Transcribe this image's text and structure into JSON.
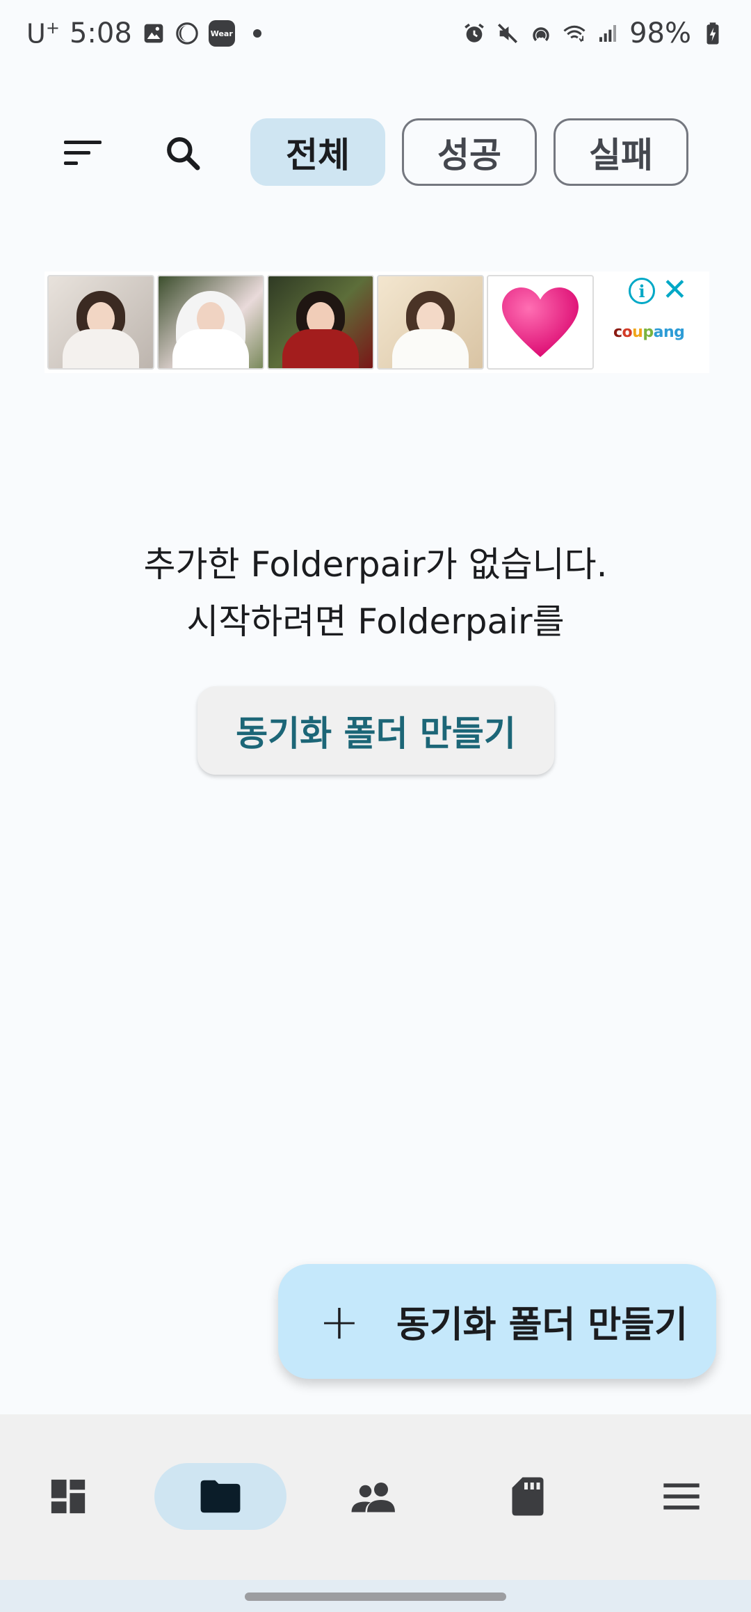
{
  "status_bar": {
    "carrier": "U",
    "carrier_sup": "+",
    "time": "5:08",
    "wear_label": "Wear",
    "battery": "98%",
    "icons": [
      "gallery-icon",
      "do-not-disturb-icon",
      "wear-icon",
      "alarm-icon",
      "mute-icon",
      "hotspot-icon",
      "wifi-icon",
      "signal-icon",
      "battery-charging-icon"
    ]
  },
  "filters": {
    "all": "전체",
    "success": "성공",
    "fail": "실패",
    "active": "all"
  },
  "ad": {
    "brand_letters": [
      "c",
      "o",
      "u",
      "p",
      "a",
      "ng"
    ],
    "info_label": "i",
    "close_label": "✕"
  },
  "empty_state": {
    "line1": "추가한 Folderpair가 없습니다.",
    "line2": "시작하려면 Folderpair를",
    "button_label": "동기화 폴더 만들기"
  },
  "fab": {
    "icon": "+",
    "label": "동기화 폴더 만들기"
  },
  "bottom_nav": {
    "items": [
      "dashboard-icon",
      "folder-icon",
      "people-icon",
      "sd-card-icon",
      "menu-icon"
    ],
    "active": "folder-icon"
  },
  "colors": {
    "background": "#f9fbfd",
    "chip_active": "#cfe5f2",
    "fab": "#c5e8fb",
    "button_text": "#1c6677",
    "ad_accent": "#00a8c6"
  }
}
